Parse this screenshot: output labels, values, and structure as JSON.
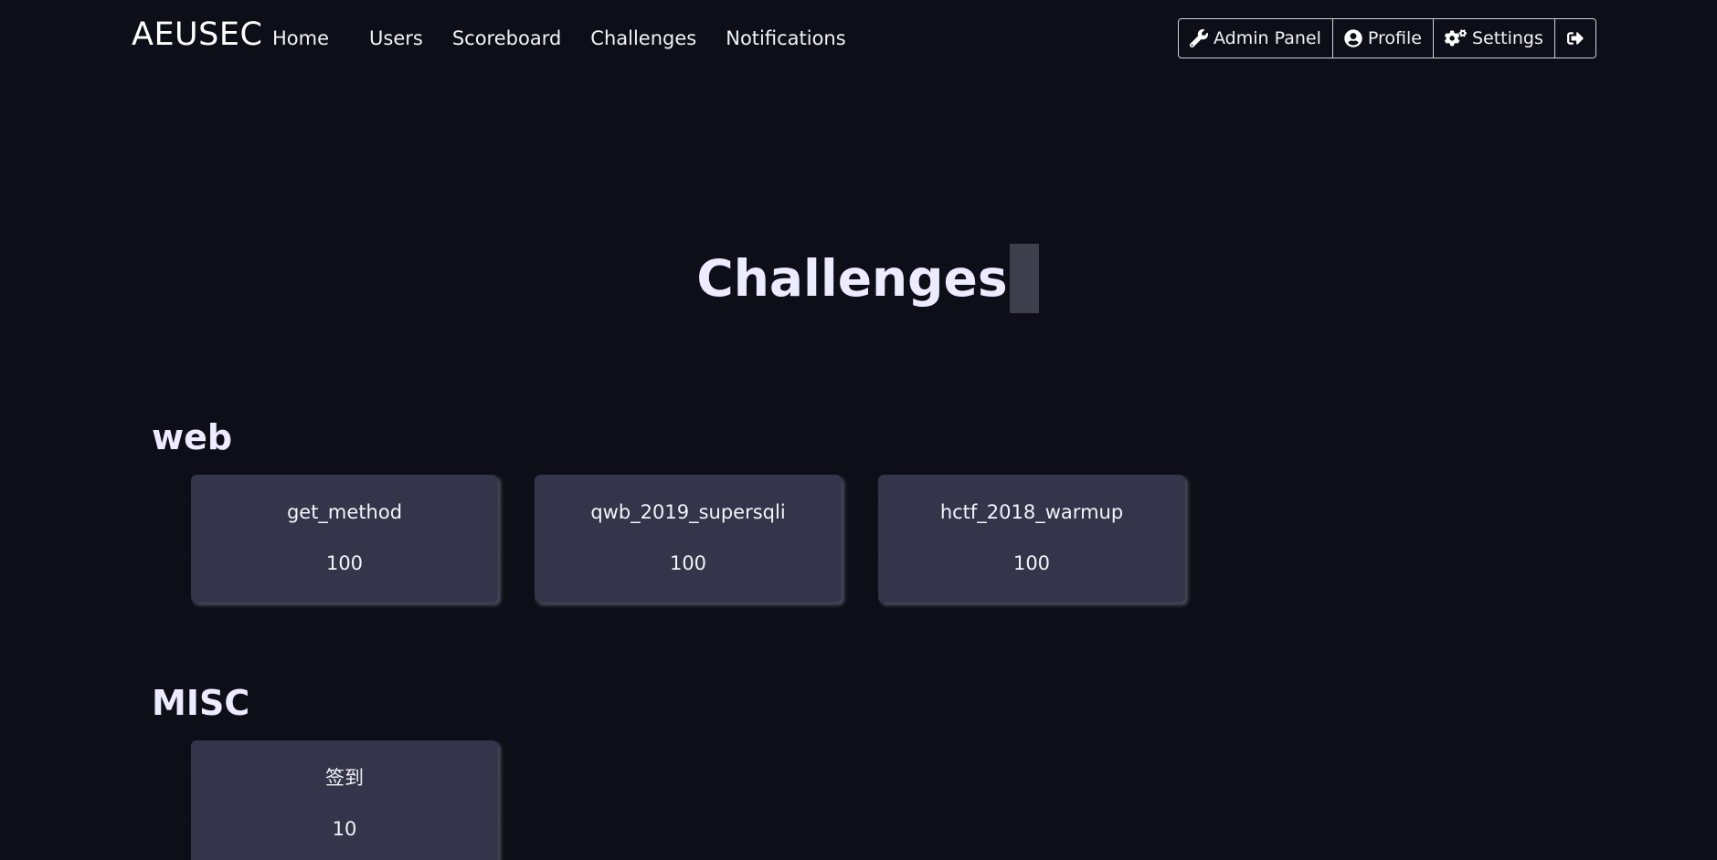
{
  "navbar": {
    "brand": "AEUSEC",
    "links": [
      "Home",
      "Users",
      "Scoreboard",
      "Challenges",
      "Notifications"
    ],
    "buttons": {
      "admin_panel": "Admin Panel",
      "profile": "Profile",
      "settings": "Settings"
    },
    "icons": {
      "admin_panel": "wrench-icon",
      "profile": "user-circle-icon",
      "settings": "cogs-icon",
      "logout": "sign-out-icon"
    }
  },
  "page": {
    "title": "Challenges"
  },
  "categories": [
    {
      "name": "web",
      "challenges": [
        {
          "name": "get_method",
          "value": "100"
        },
        {
          "name": "qwb_2019_supersqli",
          "value": "100"
        },
        {
          "name": "hctf_2018_warmup",
          "value": "100"
        }
      ]
    },
    {
      "name": "MISC",
      "challenges": [
        {
          "name": "签到",
          "value": "10"
        }
      ]
    }
  ],
  "colors": {
    "background": "#0d0e17",
    "card": "#34344a",
    "text": "#ecebff"
  }
}
